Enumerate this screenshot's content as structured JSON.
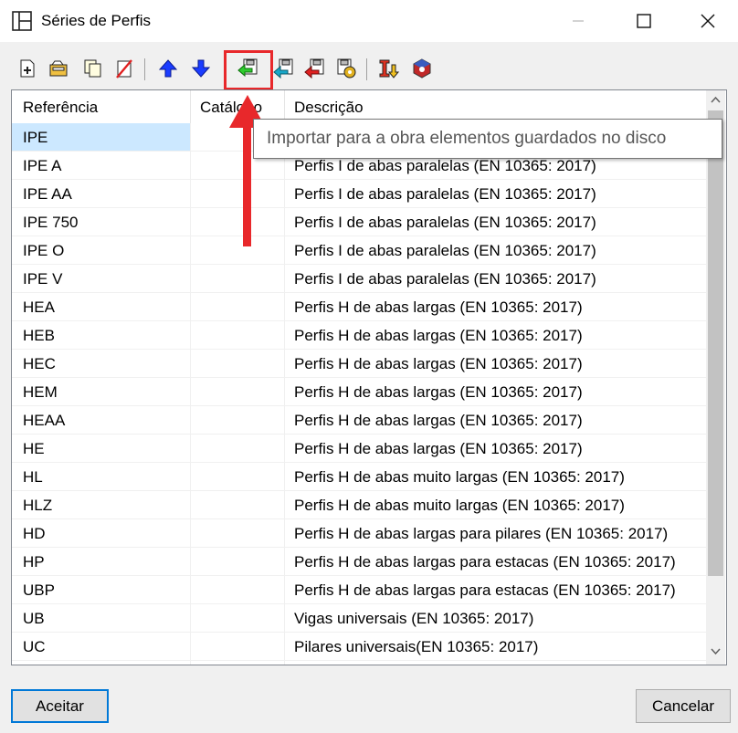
{
  "window": {
    "title": "Séries de Perfis"
  },
  "columns": [
    "Referência",
    "Catálogo",
    "Descrição"
  ],
  "rows": [
    {
      "ref": "IPE",
      "desc": ""
    },
    {
      "ref": "IPE A",
      "desc": "Perfis I de abas paralelas (EN 10365: 2017)"
    },
    {
      "ref": "IPE AA",
      "desc": "Perfis I de abas paralelas (EN 10365: 2017)"
    },
    {
      "ref": "IPE 750",
      "desc": "Perfis I de abas paralelas (EN 10365: 2017)"
    },
    {
      "ref": "IPE O",
      "desc": "Perfis I de abas paralelas (EN 10365: 2017)"
    },
    {
      "ref": "IPE V",
      "desc": "Perfis I de abas paralelas (EN 10365: 2017)"
    },
    {
      "ref": "HEA",
      "desc": "Perfis H de abas largas (EN 10365: 2017)"
    },
    {
      "ref": "HEB",
      "desc": "Perfis H de abas largas (EN 10365: 2017)"
    },
    {
      "ref": "HEC",
      "desc": "Perfis H de abas largas (EN 10365: 2017)"
    },
    {
      "ref": "HEM",
      "desc": "Perfis H de abas largas (EN 10365: 2017)"
    },
    {
      "ref": "HEAA",
      "desc": "Perfis H de abas largas (EN 10365: 2017)"
    },
    {
      "ref": "HE",
      "desc": "Perfis H de abas largas (EN 10365: 2017)"
    },
    {
      "ref": "HL",
      "desc": "Perfis H de abas muito largas (EN 10365: 2017)"
    },
    {
      "ref": "HLZ",
      "desc": "Perfis H de abas muito largas (EN 10365: 2017)"
    },
    {
      "ref": "HD",
      "desc": "Perfis H de abas largas para pilares (EN 10365: 2017)"
    },
    {
      "ref": "HP",
      "desc": "Perfis H de abas largas para estacas (EN 10365: 2017)"
    },
    {
      "ref": "UBP",
      "desc": "Perfis H de abas largas para estacas (EN 10365: 2017)"
    },
    {
      "ref": "UB",
      "desc": "Vigas universais (EN 10365: 2017)"
    },
    {
      "ref": "UC",
      "desc": "Pilares universais(EN 10365: 2017)"
    }
  ],
  "tooltip": "Importar para a obra elementos guardados no disco",
  "buttons": {
    "accept": "Aceitar",
    "cancel": "Cancelar"
  },
  "colors": {
    "highlight": "#e8282b",
    "selection": "#cce8ff",
    "accent": "#0078d7"
  }
}
